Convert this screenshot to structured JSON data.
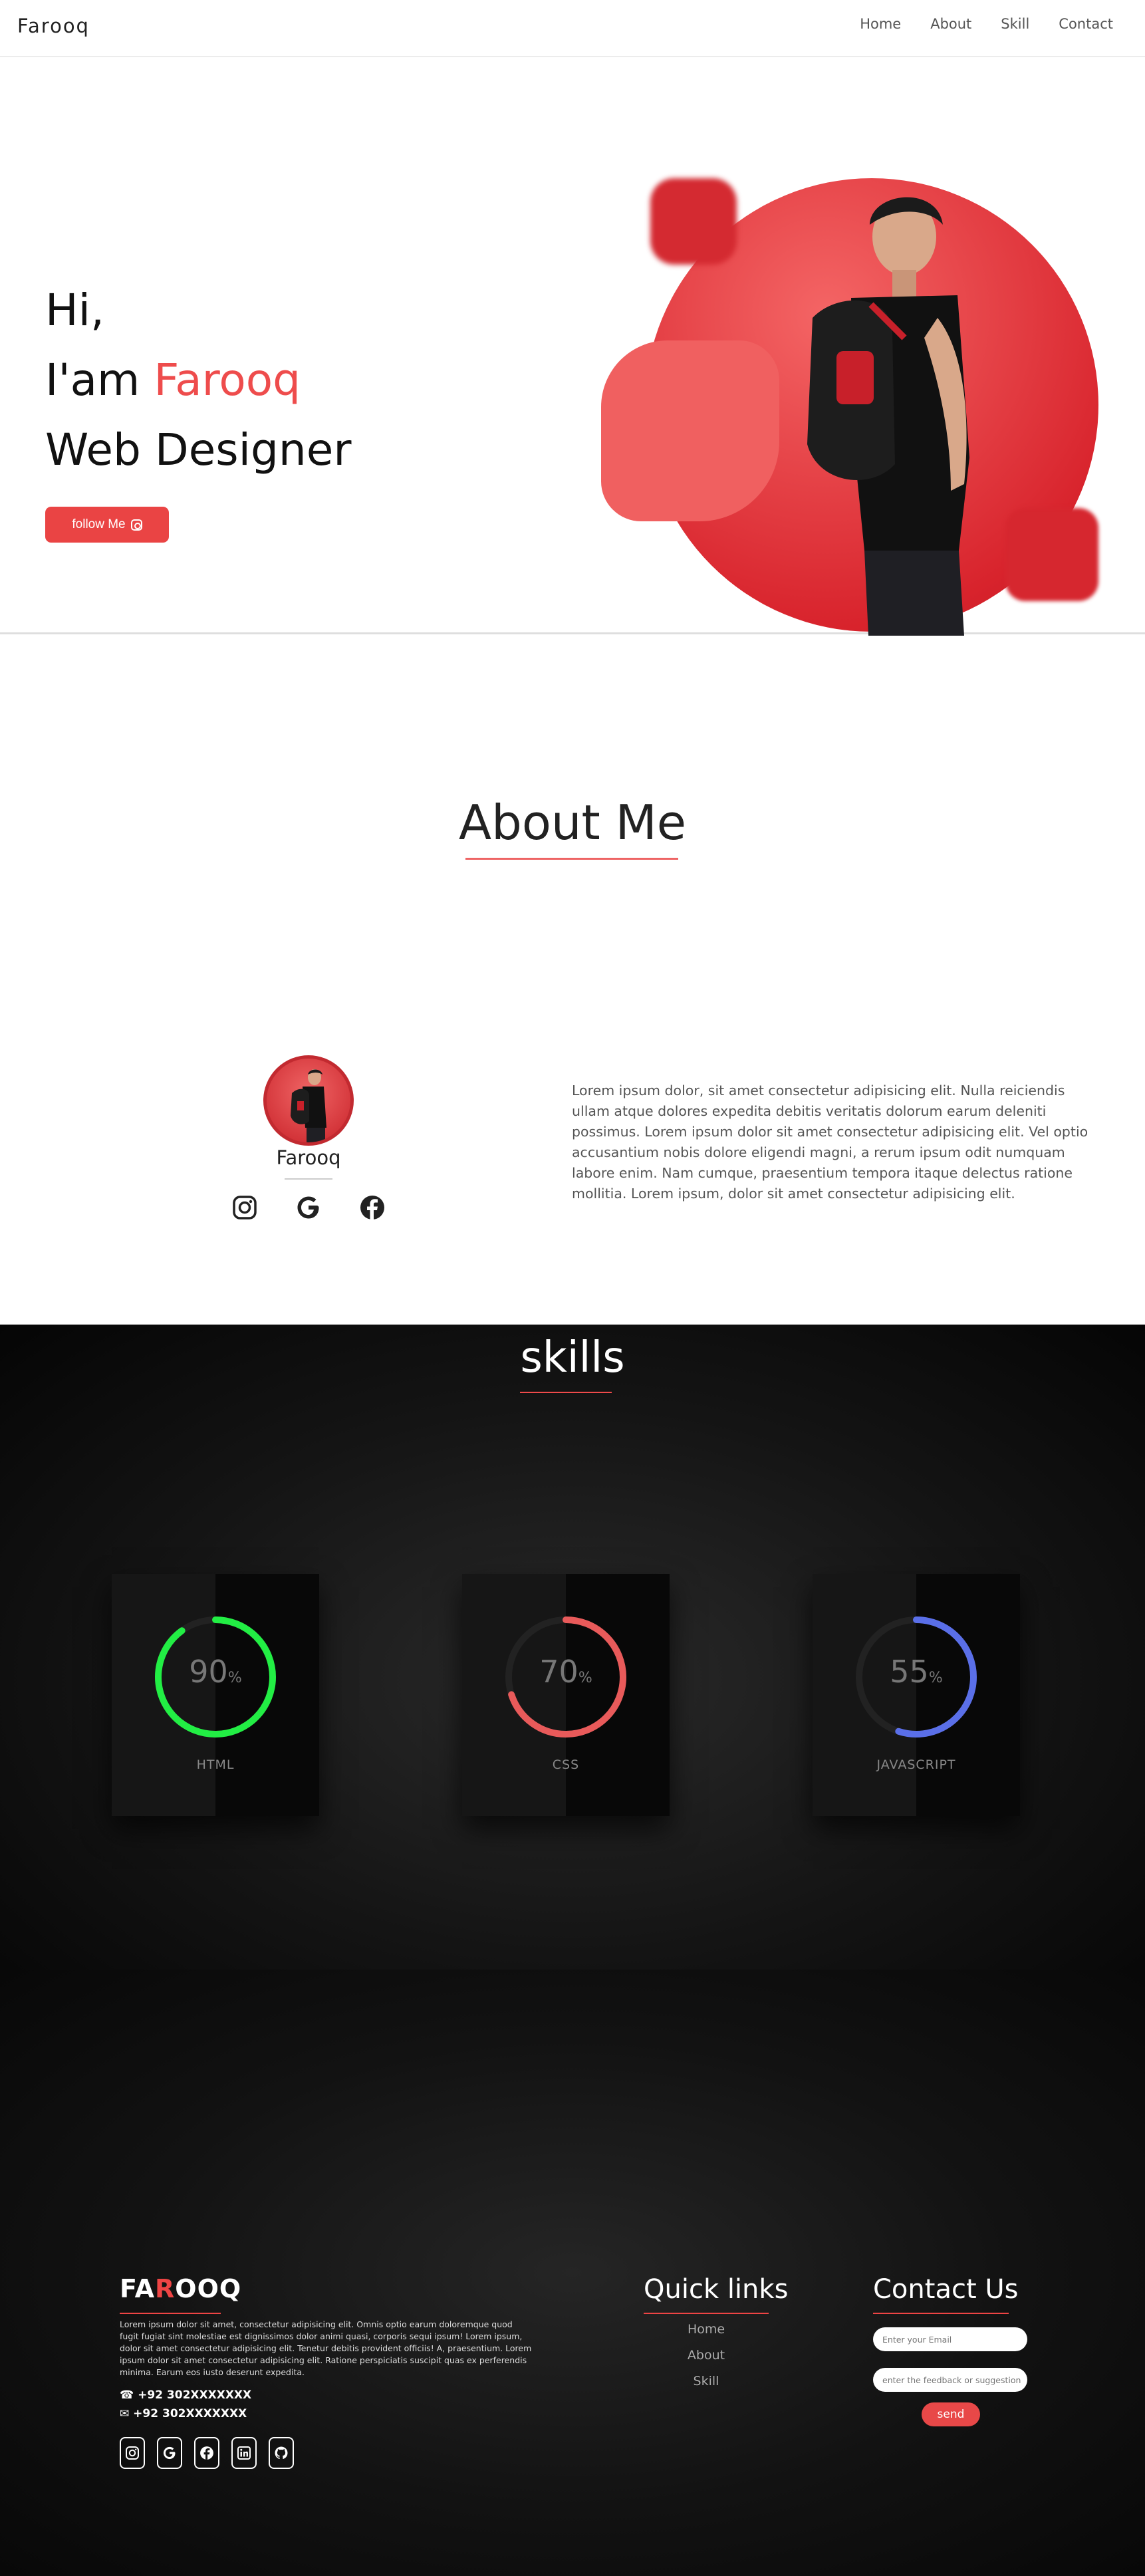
{
  "nav": {
    "brand": "Farooq",
    "links": [
      "Home",
      "About",
      "Skill",
      "Contact"
    ]
  },
  "hero": {
    "line1": "Hi,",
    "line2_prefix": "I'am ",
    "line2_name": "Farooq",
    "line3": "Web Designer",
    "follow_label": "follow Me"
  },
  "about": {
    "title": "About Me",
    "name": "Farooq",
    "text": "Lorem ipsum dolor, sit amet consectetur adipisicing elit. Nulla reiciendis ullam atque dolores expedita debitis veritatis dolorum earum deleniti possimus. Lorem ipsum dolor sit amet consectetur adipisicing elit. Vel optio accusantium nobis dolore eligendi magni, a rerum ipsum odit numquam labore enim. Nam cumque, praesentium tempora itaque delectus ratione mollitia. Lorem ipsum, dolor sit amet consectetur adipisicing elit.",
    "socials": [
      "instagram-icon",
      "google-icon",
      "facebook-icon"
    ]
  },
  "skills": {
    "title": "skills",
    "items": [
      {
        "label": "HTML",
        "value": "90",
        "unit": "%",
        "percent": 90,
        "color": "#22ee44"
      },
      {
        "label": "CSS",
        "value": "70",
        "unit": "%",
        "percent": 70,
        "color": "#e85a5a"
      },
      {
        "label": "JAVASCRIPT",
        "value": "55",
        "unit": "%",
        "percent": 55,
        "color": "#5a6fe8"
      }
    ]
  },
  "footer": {
    "brand_a": "FA",
    "brand_b": "R",
    "brand_c": "OOQ",
    "text": "Lorem ipsum dolor sit amet, consectetur adipisicing elit. Omnis optio earum doloremque quod fugit fugiat sint molestiae est dignissimos dolor animi quasi, corporis sequi ipsum! Lorem ipsum, dolor sit amet consectetur adipisicing elit. Tenetur debitis provident officiis! A, praesentium. Lorem ipsum dolor sit amet consectetur adipisicing elit. Ratione perspiciatis suscipit quas ex perferendis minima. Earum eos iusto deserunt expedita.",
    "phone1": "+92 302XXXXXXX",
    "phone2": "+92 302XXXXXXX",
    "quick_title": "Quick links",
    "quick_links": [
      "Home",
      "About",
      "Skill"
    ],
    "contact_title": "Contact Us",
    "email_placeholder": "Enter your Email",
    "feedback_placeholder": "enter the feedback or suggestion",
    "send_label": "send"
  }
}
